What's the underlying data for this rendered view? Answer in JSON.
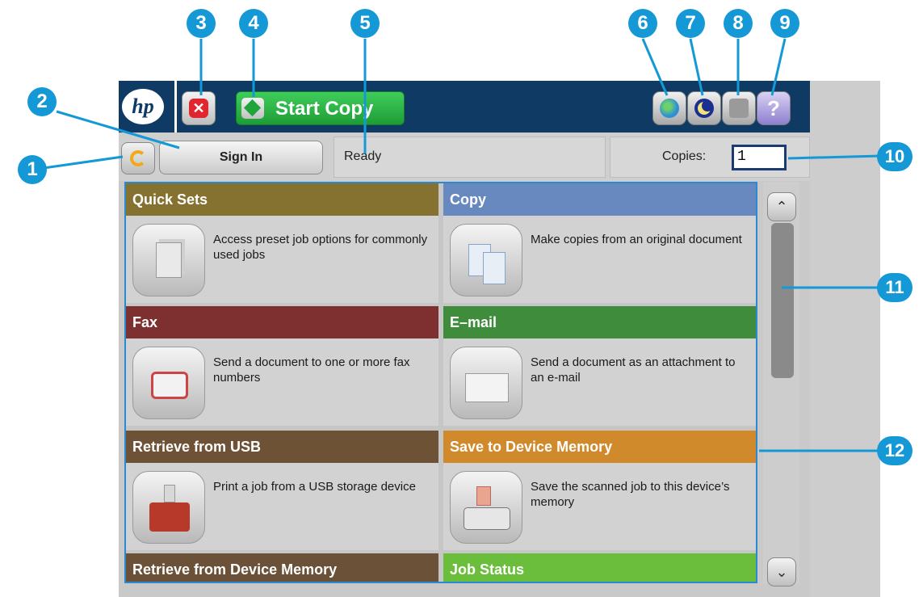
{
  "header": {
    "logo_text": "hp",
    "start_label": "Start Copy"
  },
  "status": {
    "signin_label": "Sign In",
    "ready_text": "Ready",
    "copies_label": "Copies:",
    "copies_value": "1"
  },
  "tiles": [
    {
      "title": "Quick Sets",
      "description": "Access preset job options for commonly used jobs",
      "color": "#857231",
      "icon": "document-clip-icon"
    },
    {
      "title": "Copy",
      "description": "Make copies from an original document",
      "color": "#6789bf",
      "icon": "copy-documents-icon"
    },
    {
      "title": "Fax",
      "description": "Send a document to one or more fax numbers",
      "color": "#7e3031",
      "icon": "fax-machine-icon"
    },
    {
      "title": "E–mail",
      "description": "Send a document as an attachment to an e-mail",
      "color": "#3f8c3c",
      "icon": "envelope-icon"
    },
    {
      "title": "Retrieve from USB",
      "description": "Print a job from a USB storage device",
      "color": "#6e5236",
      "icon": "usb-icon"
    },
    {
      "title": "Save to Device Memory",
      "description": "Save the scanned job to this device’s memory",
      "color": "#d08a2b",
      "icon": "drive-save-icon"
    }
  ],
  "bottom_tiles": [
    {
      "title": "Retrieve from Device Memory",
      "color": "#6a5138"
    },
    {
      "title": "Job Status",
      "color": "#6bbd3c"
    }
  ],
  "callouts": [
    "1",
    "2",
    "3",
    "4",
    "5",
    "6",
    "7",
    "8",
    "9",
    "10",
    "11",
    "12"
  ],
  "colors": {
    "topbar": "#0e3a63",
    "callout": "#1599d6",
    "start_green": "#2bb148",
    "stop_red": "#e0262e",
    "grid_border": "#2a8ad1"
  }
}
